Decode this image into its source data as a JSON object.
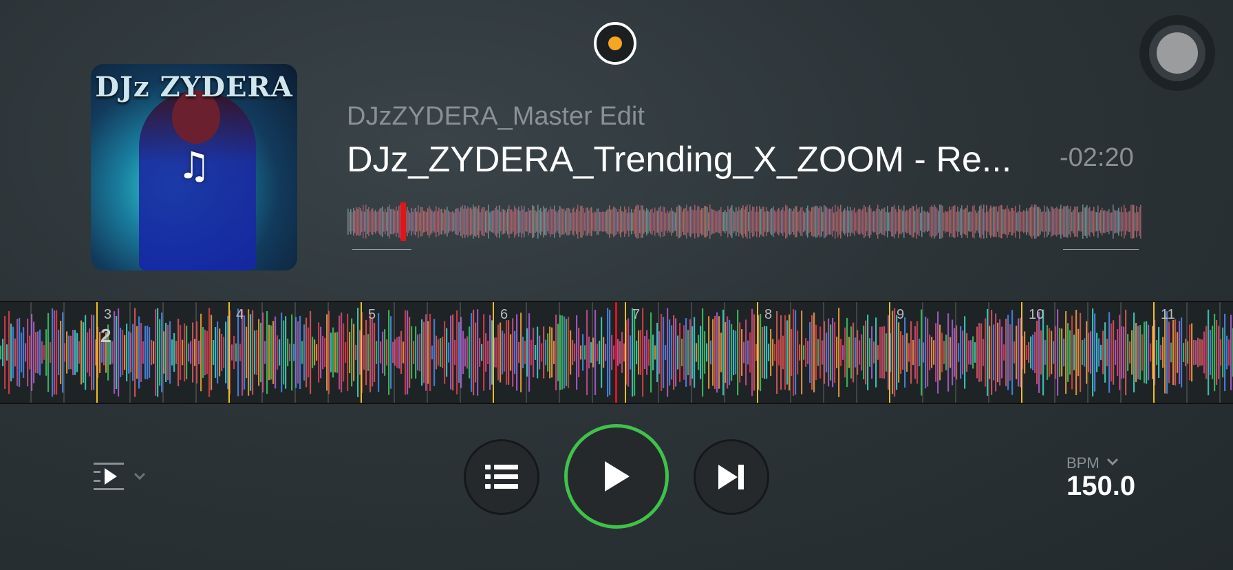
{
  "deck": {
    "subtitle": "DJzZYDERA_Master Edit",
    "title": "DJz_ZYDERA_Trending_X_ZOOM - Re...",
    "time_remaining": "-02:20",
    "artwork_text": "DJz ZYDERA",
    "artwork_icon": "music-note-icon"
  },
  "beat_markers": [
    "3",
    "4",
    "5",
    "6",
    "7",
    "8",
    "9",
    "10",
    "11"
  ],
  "loop_badge": "2",
  "playback_progress": 0.07,
  "tempo": {
    "label": "BPM",
    "value": "150.0"
  },
  "controls": {
    "queue_mode_icon": "play-queue-icon",
    "list_icon": "list-icon",
    "play_icon": "play-icon",
    "next_icon": "skip-next-icon"
  },
  "colors": {
    "accent_play_ring": "#3fc24a",
    "playhead": "#e0141a",
    "beat_line": "#f0c020",
    "record_dot": "#f5a623"
  }
}
